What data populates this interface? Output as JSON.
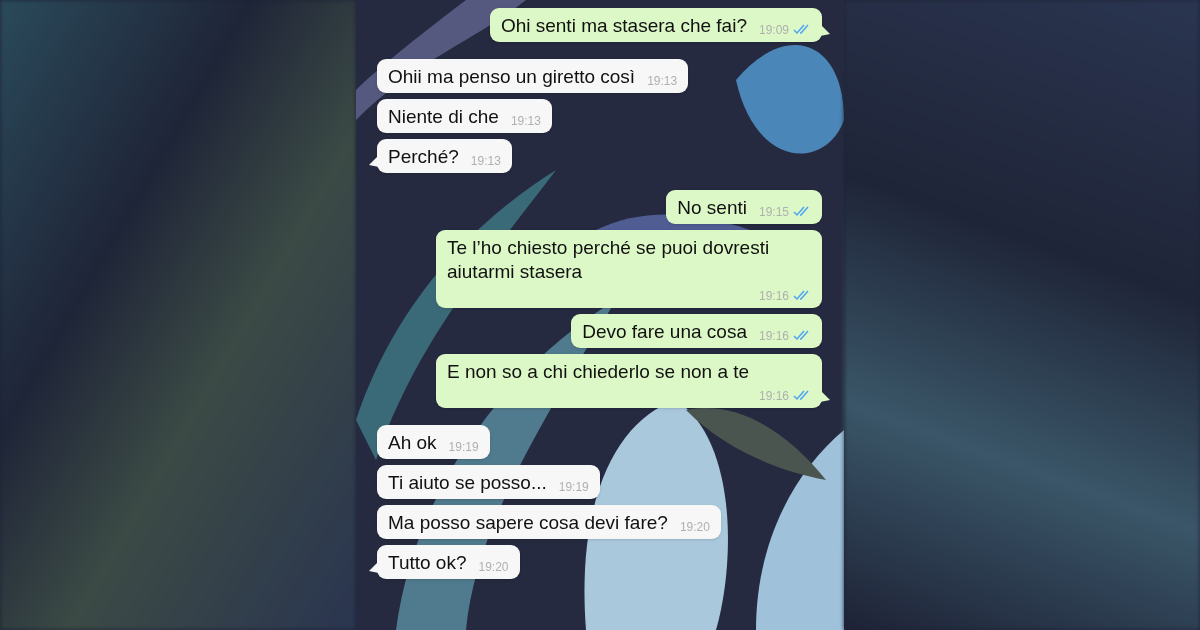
{
  "messages": [
    {
      "kind": "sent",
      "text": "Ohi senti ma stasera che fai?",
      "time": "19:09",
      "read": true
    },
    {
      "kind": "received",
      "text": "Ohii ma penso un giretto così",
      "time": "19:13"
    },
    {
      "kind": "received",
      "text": "Niente di che",
      "time": "19:13"
    },
    {
      "kind": "received",
      "text": "Perché?",
      "time": "19:13"
    },
    {
      "kind": "sent",
      "text": "No senti",
      "time": "19:15",
      "read": true
    },
    {
      "kind": "sent",
      "text": "Te l’ho chiesto perché se puoi dovresti aiutarmi stasera",
      "time": "19:16",
      "read": true
    },
    {
      "kind": "sent",
      "text": "Devo fare una cosa",
      "time": "19:16",
      "read": true
    },
    {
      "kind": "sent",
      "text": "E non so a chi chiederlo se non a te",
      "time": "19:16",
      "read": true
    },
    {
      "kind": "received",
      "text": "Ah ok",
      "time": "19:19"
    },
    {
      "kind": "received",
      "text": "Ti aiuto se posso...",
      "time": "19:19"
    },
    {
      "kind": "received",
      "text": "Ma posso sapere cosa devi fare?",
      "time": "19:20"
    },
    {
      "kind": "received",
      "text": "Tutto ok?",
      "time": "19:20"
    }
  ]
}
